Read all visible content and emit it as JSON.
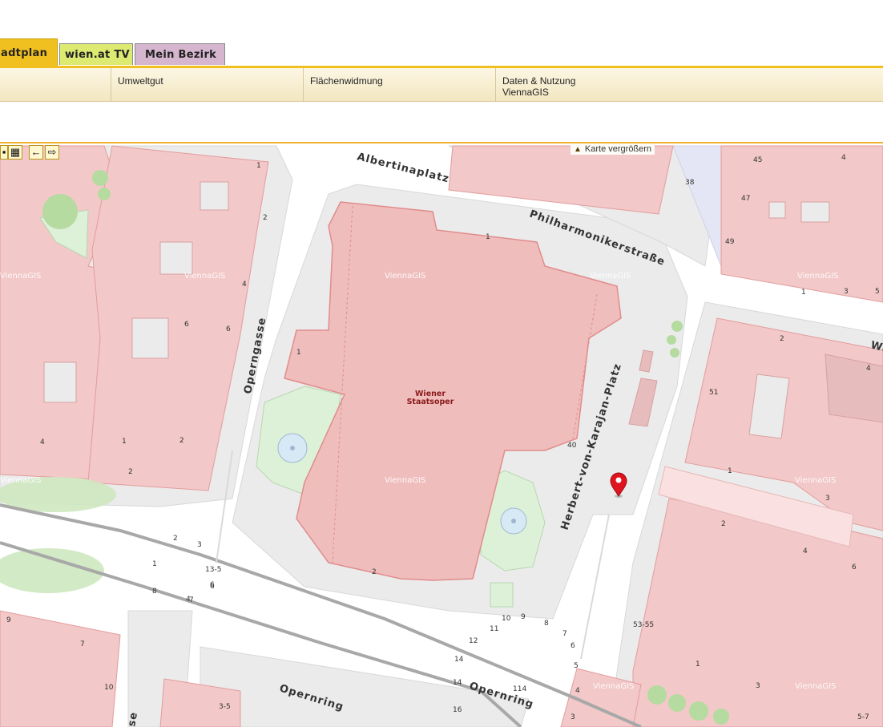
{
  "tabs": [
    {
      "label": "adtplan",
      "active": true
    },
    {
      "label": "wien.at TV",
      "active": false
    },
    {
      "label": "Mein Bezirk",
      "active": false
    }
  ],
  "menu": {
    "col1": "Umweltgut",
    "col2": "Flächenwidmung",
    "col3_line1": "Daten & Nutzung",
    "col3_line2": "ViennaGIS"
  },
  "map": {
    "zoom_link": "Karte vergrößern",
    "tool_icons": [
      "map-section-icon",
      "zoom-fit-icon",
      "pan-left-icon",
      "pan-right-icon"
    ],
    "watermark": "ViennaGIS",
    "landmark": {
      "line1": "Wiener",
      "line2": "Staatsoper"
    },
    "streets": {
      "albertina": "Albertinaplatz",
      "philharmoniker": "Philharmonikerstraße",
      "operngasse": "Operngasse",
      "karajan": "Herbert-von-Karajan-Platz",
      "opernring": "Opernring",
      "edge_wa": "Wa",
      "edge_se": "se"
    },
    "house_numbers": [
      "1",
      "2",
      "4",
      "6",
      "6",
      "4",
      "2",
      "38",
      "45",
      "4",
      "47",
      "49",
      "1",
      "3",
      "5",
      "1",
      "2",
      "4",
      "51",
      "1",
      "3",
      "2",
      "4",
      "6",
      "1",
      "3",
      "53-55",
      "40",
      "1",
      "2",
      "1",
      "2",
      "6",
      "4",
      "9",
      "7",
      "10",
      "1",
      "3",
      "2",
      "8",
      "7",
      "6",
      "13-5",
      "11",
      "12",
      "10",
      "9",
      "8",
      "14",
      "14",
      "114",
      "7",
      "6",
      "5",
      "4",
      "3",
      "16",
      "3-5",
      "5-7"
    ],
    "colors": {
      "building": "#f2c8c8",
      "building_edge": "#e39c9c",
      "street": "#ffffff",
      "block": "#ebebeb",
      "park": "#ddf0d8",
      "tree": "#b5dba0",
      "opera": "#f0bdbd",
      "marker": "#e0141e",
      "accent": "#f0c020"
    }
  }
}
